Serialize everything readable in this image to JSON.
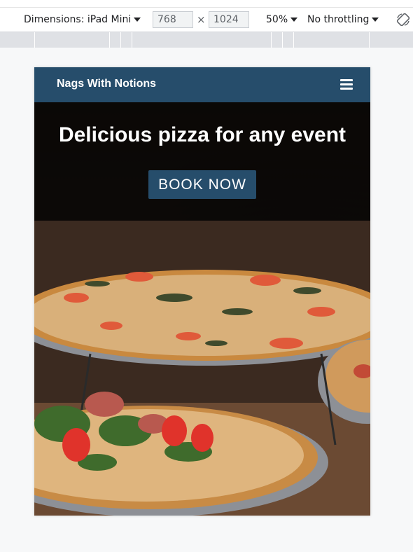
{
  "devtools": {
    "dimensions_label": "Dimensions: iPad Mini",
    "width_value": "768",
    "times_symbol": "×",
    "height_value": "1024",
    "zoom": "50%",
    "throttling": "No throttling",
    "rotate_icon": "rotate-icon"
  },
  "site": {
    "brand": "Nags With Notions",
    "menu_icon": "hamburger-menu-icon",
    "hero_title": "Delicious pizza for any event",
    "cta_label": "BOOK NOW",
    "colors": {
      "navbar": "#264d6b",
      "button": "#264d6b",
      "hero_overlay": "#050403"
    }
  }
}
